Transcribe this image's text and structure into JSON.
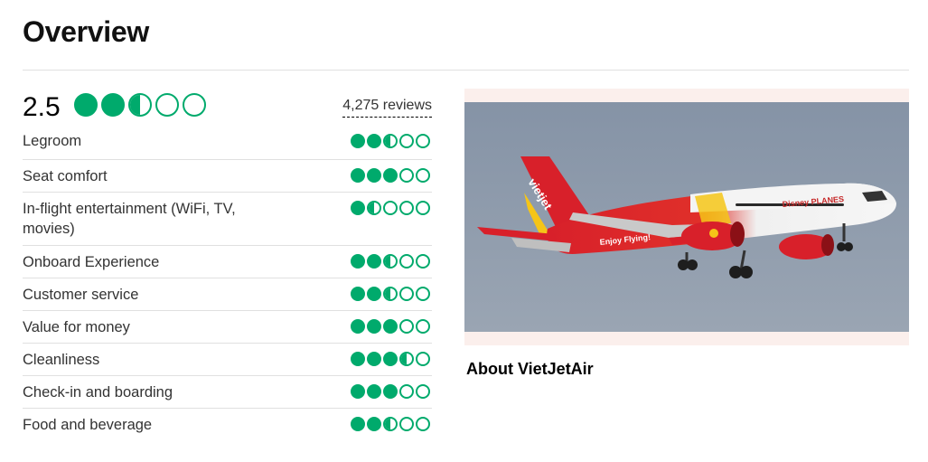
{
  "page": {
    "title": "Overview"
  },
  "overall": {
    "score": "2.5",
    "rating": 2.5,
    "reviews_label": "4,275 reviews"
  },
  "categories": [
    {
      "label": "Legroom",
      "rating": 2.5
    },
    {
      "label": "Seat comfort",
      "rating": 3
    },
    {
      "label": "In-flight entertainment (WiFi, TV, movies)",
      "rating": 1.5
    },
    {
      "label": "Onboard Experience",
      "rating": 2.5
    },
    {
      "label": "Customer service",
      "rating": 2.5
    },
    {
      "label": "Value for money",
      "rating": 3
    },
    {
      "label": "Cleanliness",
      "rating": 3.5
    },
    {
      "label": "Check-in and boarding",
      "rating": 3
    },
    {
      "label": "Food and beverage",
      "rating": 2.5
    }
  ],
  "aircraft": {
    "livery_brand": "vietjet",
    "livery_slogan": "Enjoy Flying!",
    "livery_partner": "Disney PLANES"
  },
  "about": {
    "label": "About VietJetAir"
  },
  "colors": {
    "bubble": "#00aa6c",
    "photo_bg": "#fbefec",
    "sky": "#8a97a8",
    "livery_red": "#d8202a",
    "livery_yellow": "#f5c518"
  }
}
